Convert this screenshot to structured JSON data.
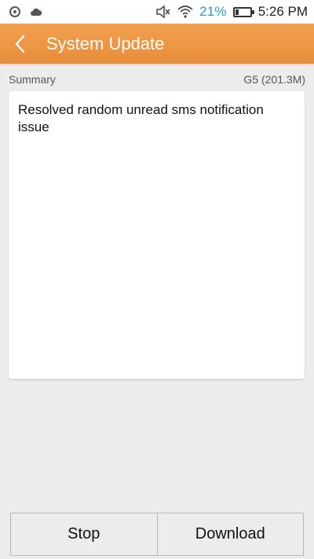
{
  "status_bar": {
    "icons_left": [
      "record-icon",
      "cloud-icon"
    ],
    "icons_right": [
      "mute-icon",
      "wifi-icon",
      "battery-icon"
    ],
    "battery_percent": "21%",
    "battery_level": 0.21,
    "time": "5:26 PM",
    "battery_color": "#2a9bd5"
  },
  "header": {
    "title": "System Update",
    "back_icon": "chevron-left-icon",
    "color": "#ec9340"
  },
  "summary": {
    "label": "Summary",
    "version": "G5 (201.3M)"
  },
  "content": {
    "text": "Resolved random unread sms notification issue"
  },
  "actions": {
    "stop_label": "Stop",
    "download_label": "Download"
  }
}
